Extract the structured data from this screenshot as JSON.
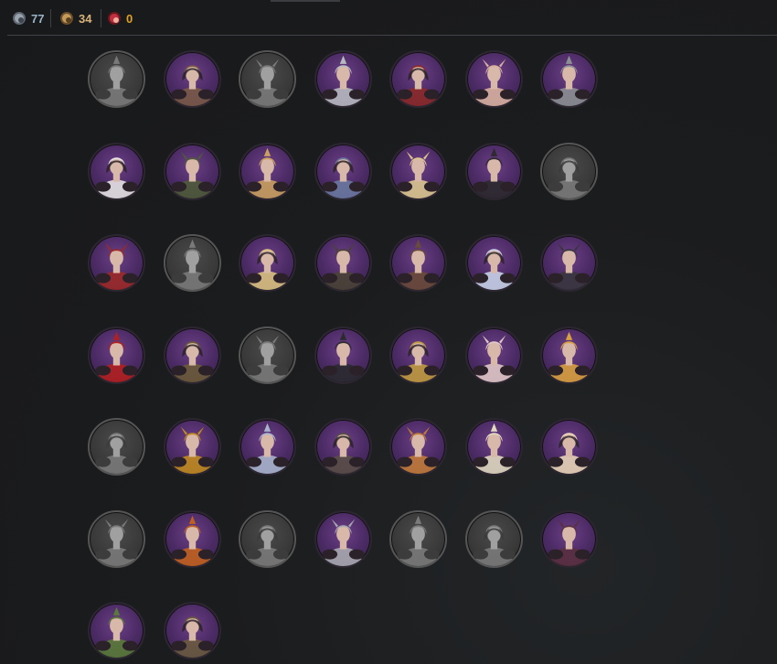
{
  "currencies": [
    {
      "name": "silver",
      "icon": "silver-coin-icon",
      "value": "77",
      "color": "#9ab3c8"
    },
    {
      "name": "gold",
      "icon": "gold-coin-icon",
      "value": "34",
      "color": "#d9b27a"
    },
    {
      "name": "red",
      "icon": "red-gem-icon",
      "value": "0",
      "color": "#e0a020"
    }
  ],
  "colors": {
    "owned_bg": "#4a2a63",
    "locked_bg": "#3a3a3a"
  },
  "portraits": [
    {
      "name": "hooded-warrior",
      "status": "locked",
      "tone": "#888"
    },
    {
      "name": "hooded-monk",
      "status": "owned",
      "tone": "#7a5a48"
    },
    {
      "name": "veiled-figure",
      "status": "locked",
      "tone": "#777"
    },
    {
      "name": "silver-armored-maiden",
      "status": "owned",
      "tone": "#b7b9c0"
    },
    {
      "name": "horned-queen",
      "status": "owned",
      "tone": "#8a2a2a"
    },
    {
      "name": "blonde-noble",
      "status": "owned",
      "tone": "#d8b0a0"
    },
    {
      "name": "steel-knight",
      "status": "owned",
      "tone": "#8c8f94"
    },
    {
      "name": "white-plumed-lady",
      "status": "owned",
      "tone": "#e6e2e4"
    },
    {
      "name": "green-hood-mercenary",
      "status": "owned",
      "tone": "#4f5a3a"
    },
    {
      "name": "golden-masked-sorceress",
      "status": "owned",
      "tone": "#caa060"
    },
    {
      "name": "blue-armored-paladin",
      "status": "owned",
      "tone": "#6a78a0"
    },
    {
      "name": "golden-priestess",
      "status": "owned",
      "tone": "#dcc690"
    },
    {
      "name": "dark-spiked-lord",
      "status": "owned",
      "tone": "#2e2a30"
    },
    {
      "name": "shadow-reaper",
      "status": "locked",
      "tone": "#5a5a5a"
    },
    {
      "name": "crimson-empress",
      "status": "owned",
      "tone": "#9a2a2a"
    },
    {
      "name": "black-knight",
      "status": "locked",
      "tone": "#4a4a4a"
    },
    {
      "name": "crescent-crown-lady",
      "status": "owned",
      "tone": "#d8c080"
    },
    {
      "name": "dark-gold-warlord",
      "status": "owned",
      "tone": "#4a4236"
    },
    {
      "name": "hooded-archer",
      "status": "owned",
      "tone": "#6a4a3a"
    },
    {
      "name": "blue-cape-noble",
      "status": "owned",
      "tone": "#c8d0e8"
    },
    {
      "name": "dark-horned-rogue",
      "status": "owned",
      "tone": "#3a3640"
    },
    {
      "name": "red-devil-king",
      "status": "owned",
      "tone": "#b02020"
    },
    {
      "name": "bronze-knight",
      "status": "owned",
      "tone": "#6a5a3a"
    },
    {
      "name": "pale-maiden",
      "status": "locked",
      "tone": "#9a9a9a"
    },
    {
      "name": "black-feather-witch",
      "status": "owned",
      "tone": "#2a2a30"
    },
    {
      "name": "golden-horn-warrior",
      "status": "owned",
      "tone": "#c09a40"
    },
    {
      "name": "masked-lady",
      "status": "owned",
      "tone": "#e0c8c8"
    },
    {
      "name": "golden-flame-queen",
      "status": "owned",
      "tone": "#d8a040"
    },
    {
      "name": "grey-hooded-assassin",
      "status": "locked",
      "tone": "#6a6a6a"
    },
    {
      "name": "golden-spike-lord",
      "status": "owned",
      "tone": "#c08a20"
    },
    {
      "name": "blue-silver-knight",
      "status": "owned",
      "tone": "#a8b4cc"
    },
    {
      "name": "hooded-mage",
      "status": "owned",
      "tone": "#5a4e48"
    },
    {
      "name": "wide-hat-gunslinger",
      "status": "owned",
      "tone": "#c07a3a"
    },
    {
      "name": "white-gold-paladin",
      "status": "owned",
      "tone": "#e0d8c0"
    },
    {
      "name": "gilded-princess",
      "status": "owned",
      "tone": "#e8d4b8"
    },
    {
      "name": "grey-scout",
      "status": "locked",
      "tone": "#6e6e6e"
    },
    {
      "name": "red-gold-centurion",
      "status": "owned",
      "tone": "#c06020"
    },
    {
      "name": "grey-helm-soldier",
      "status": "locked",
      "tone": "#5e5e5e"
    },
    {
      "name": "red-crest-gladiator",
      "status": "owned",
      "tone": "#a8a8b0"
    },
    {
      "name": "grey-huntress",
      "status": "locked",
      "tone": "#4e4e4e"
    },
    {
      "name": "grey-crowned-queen",
      "status": "locked",
      "tone": "#8a8a8a"
    },
    {
      "name": "dark-rose-lady",
      "status": "owned",
      "tone": "#5a3040"
    },
    {
      "name": "green-cloak-ranger",
      "status": "owned",
      "tone": "#5a7a3a"
    },
    {
      "name": "dark-helm-guard",
      "status": "owned",
      "tone": "#6a5a40"
    }
  ]
}
